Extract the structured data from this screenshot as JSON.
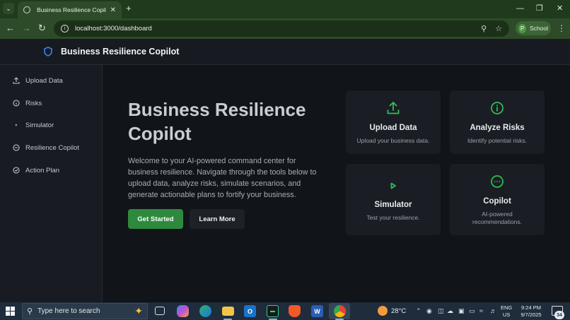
{
  "browser": {
    "tab_title": "Business Resilience Copilot",
    "url": "localhost:3000/dashboard",
    "profile_initial": "P",
    "profile_label": "School"
  },
  "app": {
    "title": "Business Resilience Copilot",
    "logo_icon": "shield-icon",
    "accent_color": "#2d8a3d",
    "logo_color": "#3b82f6"
  },
  "sidebar": {
    "items": [
      {
        "label": "Upload Data",
        "icon": "upload-icon"
      },
      {
        "label": "Risks",
        "icon": "info-icon"
      },
      {
        "label": "Simulator",
        "icon": "play-icon"
      },
      {
        "label": "Resilience Copilot",
        "icon": "chat-icon"
      },
      {
        "label": "Action Plan",
        "icon": "check-circle-icon"
      }
    ]
  },
  "hero": {
    "title": "Business Resilience Copilot",
    "description": "Welcome to your AI-powered command center for business resilience. Navigate through the tools below to upload data, analyze risks, simulate scenarios, and generate actionable plans to fortify your business.",
    "primary_button": "Get Started",
    "secondary_button": "Learn More"
  },
  "cards": [
    {
      "title": "Upload Data",
      "description": "Upload your business data.",
      "icon": "upload-icon"
    },
    {
      "title": "Analyze Risks",
      "description": "Identify potential risks.",
      "icon": "info-icon"
    },
    {
      "title": "Simulator",
      "description": "Test your resilience.",
      "icon": "play-icon"
    },
    {
      "title": "Copilot",
      "description": "AI-powered recommendations.",
      "icon": "chat-icon"
    }
  ],
  "taskbar": {
    "search_placeholder": "Type here to search",
    "weather": "28°C",
    "lang_line1": "ENG",
    "lang_line2": "US",
    "time": "9:24 PM",
    "date": "9/7/2025",
    "notifications": "34"
  }
}
